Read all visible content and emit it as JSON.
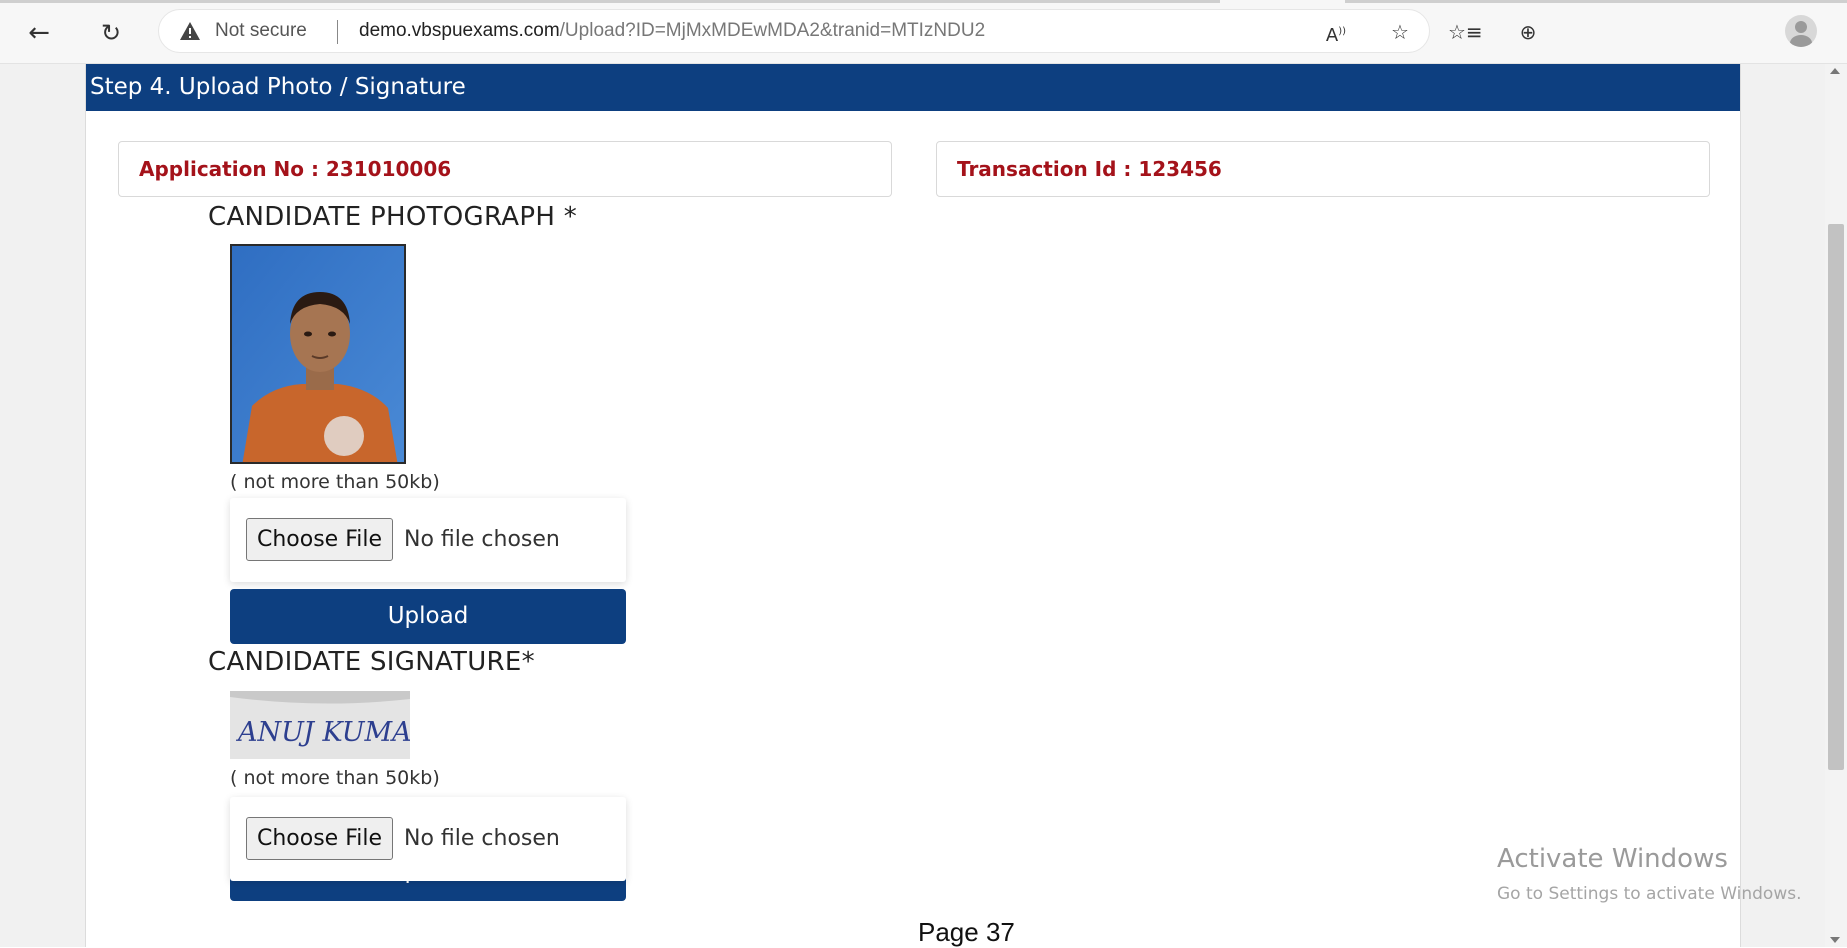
{
  "browser": {
    "not_secure_label": "Not secure",
    "url_domain": "demo.vbspuexams.com",
    "url_path": "/Upload?ID=MjMxMDEwMDA2&tranid=MTIzNDU2"
  },
  "page": {
    "step_title": "Step 4. Upload Photo / Signature",
    "application_no": "Application No : 231010006",
    "transaction_id": "Transaction Id : 123456",
    "photo": {
      "title": "CANDIDATE PHOTOGRAPH *",
      "size_note": "( not more than 50kb)",
      "choose_label": "Choose File",
      "file_status": "No file chosen",
      "upload_label": "Upload"
    },
    "signature": {
      "title": "CANDIDATE SIGNATURE*",
      "size_note": "( not more than 50kb)",
      "choose_label": "Choose File",
      "file_status": "No file chosen",
      "upload_label": "Upload",
      "signature_text": "ANUJ KUMAR"
    },
    "page_number": "Page 37"
  },
  "watermark": {
    "title": "Activate Windows",
    "subtitle": "Go to Settings to activate Windows."
  },
  "colors": {
    "header_blue": "#0d3f80",
    "label_red": "#a4121a"
  }
}
